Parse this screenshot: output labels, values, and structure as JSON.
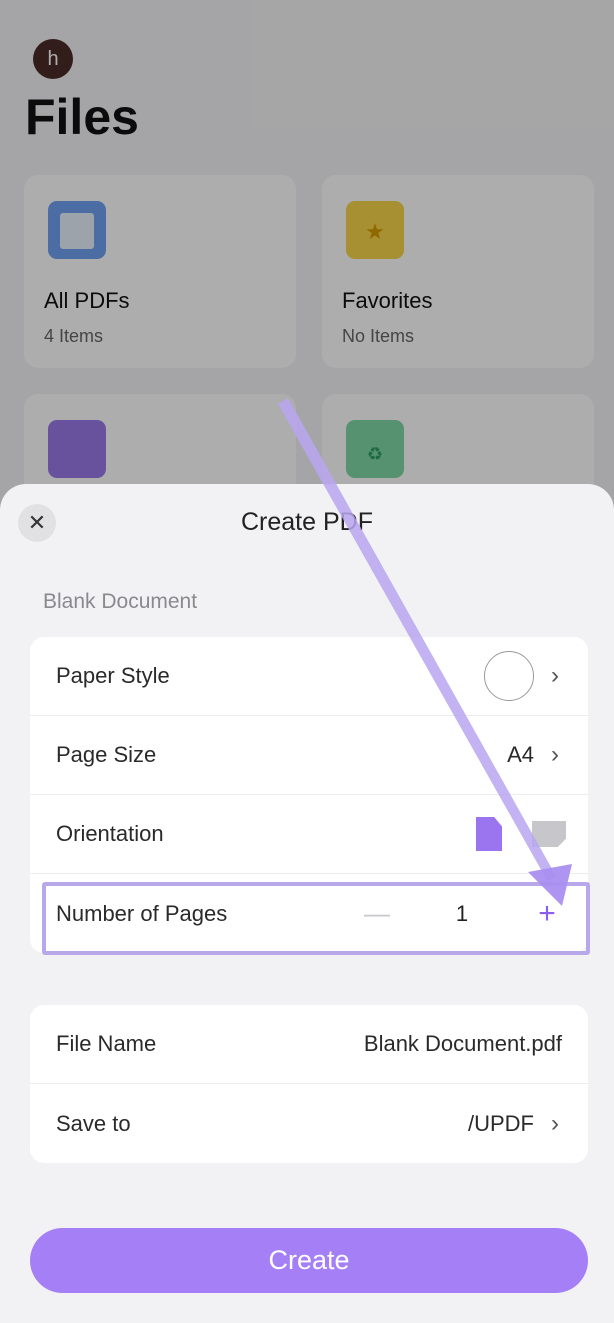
{
  "background": {
    "avatar_letter": "h",
    "title": "Files",
    "tiles": [
      {
        "name": "All PDFs",
        "count": "4 Items",
        "icon": "all-pdfs-folder-icon"
      },
      {
        "name": "Favorites",
        "count": "No Items",
        "icon": "favorites-star-folder-icon"
      },
      {
        "name": "",
        "count": "",
        "icon": "inbox-tray-icon"
      },
      {
        "name": "",
        "count": "",
        "icon": "recycle-bin-icon"
      }
    ]
  },
  "sheet": {
    "title": "Create PDF",
    "close_icon": "close-icon",
    "section_label": "Blank Document",
    "settings": {
      "paper_style": "Paper Style",
      "page_size_label": "Page Size",
      "page_size_value": "A4",
      "orientation_label": "Orientation",
      "pages_label": "Number of Pages",
      "pages_value": "1",
      "minus": "—",
      "plus": "+"
    },
    "file": {
      "name_label": "File Name",
      "name_value": "Blank Document.pdf",
      "save_label": "Save to",
      "save_value": "/UPDF"
    },
    "create_label": "Create"
  },
  "colors": {
    "accent": "#a57ff5",
    "highlight": "#b8a8ea",
    "portrait_selected": "#9b74f0"
  }
}
